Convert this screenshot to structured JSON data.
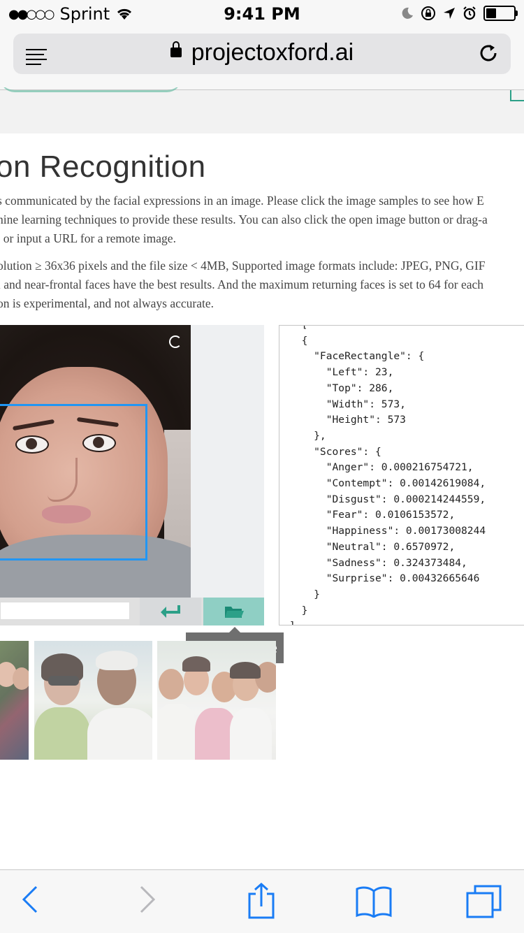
{
  "status_bar": {
    "signal": "●●○○○",
    "carrier": "Sprint",
    "time": "9:41 PM"
  },
  "browser": {
    "url": "projectoxford.ai"
  },
  "page": {
    "heading": "on Recognition",
    "para1": [
      "s communicated by the facial expressions in an image. Please click the image samples to see how E",
      "hine learning techniques to provide these results. You can also click the open image button or drag-a",
      ", or input a URL for a remote image."
    ],
    "para2": [
      "olution ≥ 36x36 pixels and the file size < 4MB, Supported image formats include: JPEG, PNG, GIF",
      "l and near-frontal faces have the best results. And the maximum returning faces is set to 64 for each",
      "on is experimental, and not always accurate."
    ]
  },
  "tooltip": "Open Image",
  "json_lines": [
    "  [",
    "  {",
    "    \"FaceRectangle\": {",
    "      \"Left\": 23,",
    "      \"Top\": 286,",
    "      \"Width\": 573,",
    "      \"Height\": 573",
    "    },",
    "    \"Scores\": {",
    "      \"Anger\": 0.000216754721,",
    "      \"Contempt\": 0.00142619084,",
    "      \"Disgust\": 0.000214244559,",
    "      \"Fear\": 0.0106153572,",
    "      \"Happiness\": 0.00173008244",
    "      \"Neutral\": 0.6570972,",
    "      \"Sadness\": 0.324373484,",
    "      \"Surprise\": 0.00432665646",
    "    }",
    "  }",
    "]"
  ],
  "colors": {
    "accent": "#2ca088",
    "face_rectangle": "#2196f3",
    "ios_blue": "#1a7cf5"
  }
}
